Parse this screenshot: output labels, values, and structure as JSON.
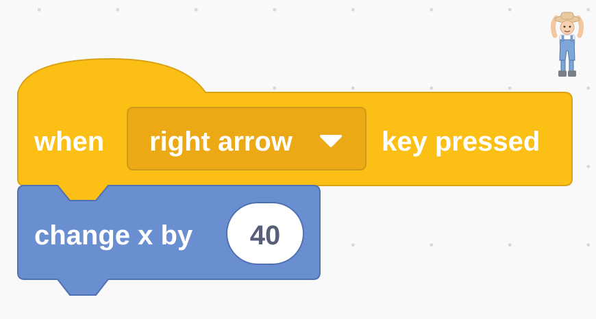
{
  "event_block": {
    "when_label": "when",
    "key_dropdown_value": "right arrow",
    "suffix_label": "key pressed",
    "color": "#FFBF00",
    "border_color": "#CC9900",
    "dropdown_color": "#E6AC00"
  },
  "motion_block": {
    "label": "change x by",
    "value": "40",
    "color": "#4C97FF",
    "border_color": "#3373CC"
  },
  "sprite": {
    "icon": "farmer-sprite-icon"
  }
}
